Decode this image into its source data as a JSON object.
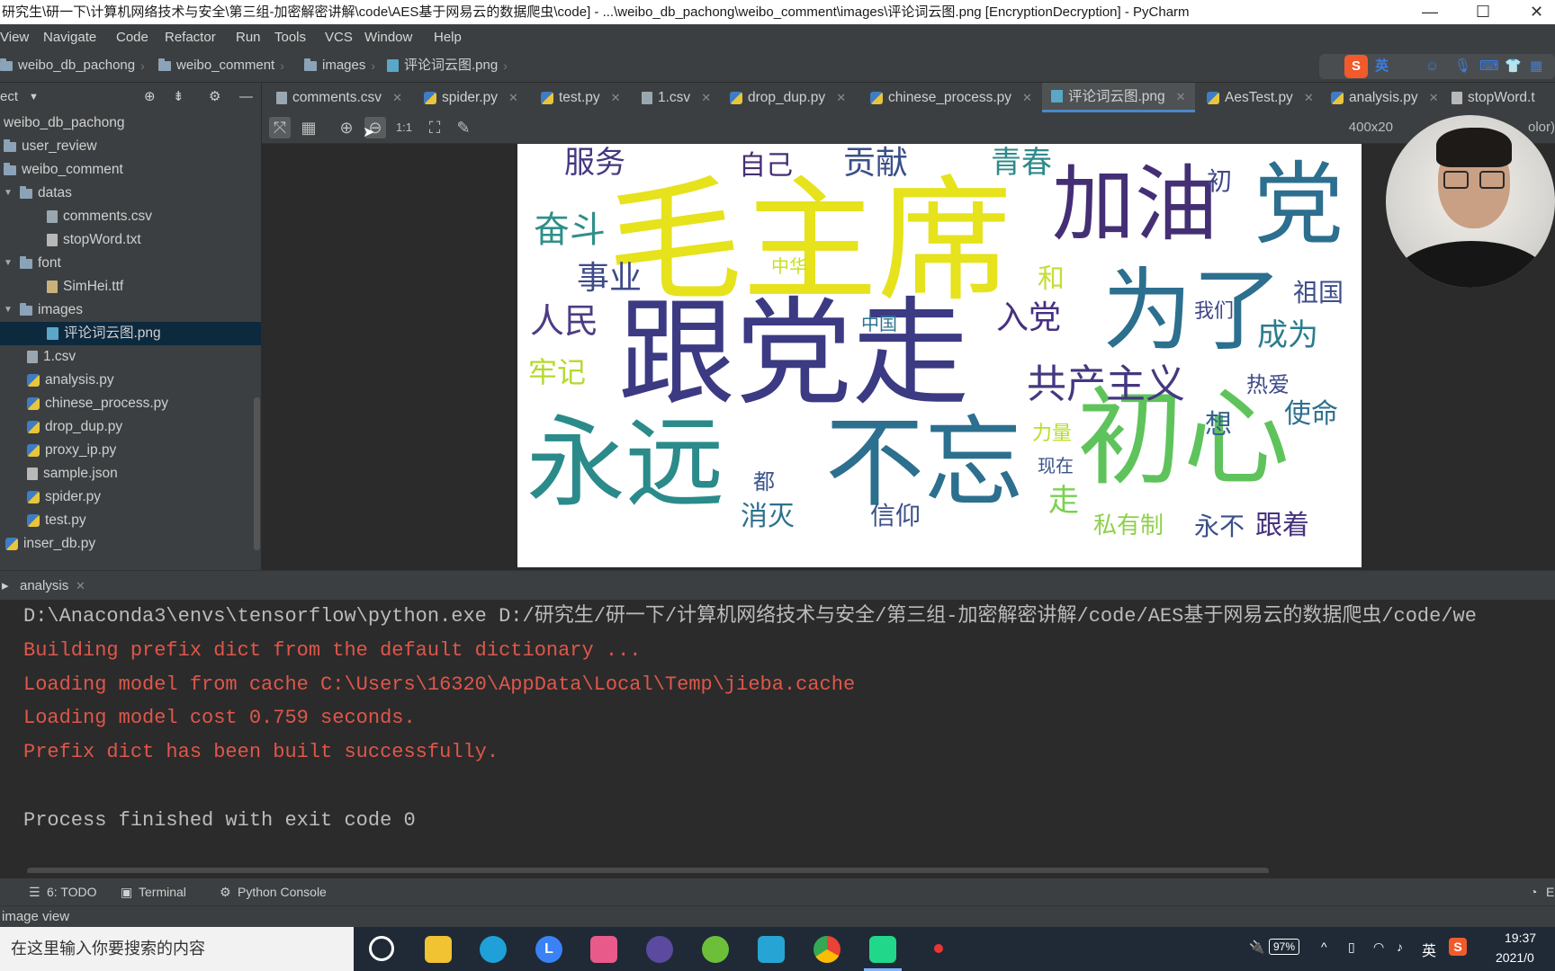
{
  "window": {
    "title": "研究生\\研一下\\计算机网络技术与安全\\第三组-加密解密讲解\\code\\AES基于网易云的数据爬虫\\code] - ...\\weibo_db_pachong\\weibo_comment\\images\\评论词云图.png [EncryptionDecryption] - PyCharm",
    "minimize": "—",
    "maximize": "☐",
    "close": "✕"
  },
  "menu": [
    "View",
    "Navigate",
    "Code",
    "Refactor",
    "Run",
    "Tools",
    "VCS",
    "Window",
    "Help"
  ],
  "breadcrumb": [
    "weibo_db_pachong",
    "weibo_comment",
    "images",
    "评论词云图.png"
  ],
  "ime": {
    "lang": "英"
  },
  "project": {
    "header": "ect",
    "tree": [
      {
        "label": "weibo_db_pachong",
        "type": "none"
      },
      {
        "label": "user_review",
        "type": "folder"
      },
      {
        "label": "weibo_comment",
        "type": "folder"
      },
      {
        "label": "datas",
        "type": "folder-open"
      },
      {
        "label": "comments.csv",
        "type": "csv"
      },
      {
        "label": "stopWord.txt",
        "type": "txt"
      },
      {
        "label": "font",
        "type": "folder-open"
      },
      {
        "label": "SimHei.ttf",
        "type": "font"
      },
      {
        "label": "images",
        "type": "folder-open"
      },
      {
        "label": "评论词云图.png",
        "type": "img",
        "selected": true
      },
      {
        "label": "1.csv",
        "type": "csv"
      },
      {
        "label": "analysis.py",
        "type": "py"
      },
      {
        "label": "chinese_process.py",
        "type": "py"
      },
      {
        "label": "drop_dup.py",
        "type": "py"
      },
      {
        "label": "proxy_ip.py",
        "type": "py"
      },
      {
        "label": "sample.json",
        "type": "json"
      },
      {
        "label": "spider.py",
        "type": "py"
      },
      {
        "label": "test.py",
        "type": "py"
      },
      {
        "label": "inser_db.py",
        "type": "py"
      }
    ]
  },
  "tabs": [
    {
      "label": "comments.csv",
      "type": "csv"
    },
    {
      "label": "spider.py",
      "type": "py"
    },
    {
      "label": "test.py",
      "type": "py"
    },
    {
      "label": "1.csv",
      "type": "csv"
    },
    {
      "label": "drop_dup.py",
      "type": "py"
    },
    {
      "label": "chinese_process.py",
      "type": "py"
    },
    {
      "label": "评论词云图.png",
      "type": "img",
      "active": true
    },
    {
      "label": "AesTest.py",
      "type": "py"
    },
    {
      "label": "analysis.py",
      "type": "py"
    },
    {
      "label": "stopWord.t",
      "type": "txt"
    }
  ],
  "image_toolbar": {
    "actual_size": "1:1",
    "info": "400x20",
    "info_tail": "olor)"
  },
  "wordcloud": {
    "words": [
      {
        "t": "毛主席",
        "c": "#e6e21c"
      },
      {
        "t": "跟党走",
        "c": "#3b3a83"
      },
      {
        "t": "永远",
        "c": "#2a8b8a"
      },
      {
        "t": "不忘",
        "c": "#2d6f8e"
      },
      {
        "t": "初心",
        "c": "#5fc35c"
      },
      {
        "t": "加油",
        "c": "#442f74"
      },
      {
        "t": "党",
        "c": "#2c6f8e"
      },
      {
        "t": "为了",
        "c": "#2c6f8e"
      },
      {
        "t": "共产主义",
        "c": "#453880"
      },
      {
        "t": "服务",
        "c": "#453880"
      },
      {
        "t": "奋斗",
        "c": "#2f8f8a"
      },
      {
        "t": "事业",
        "c": "#3e4b88"
      },
      {
        "t": "人民",
        "c": "#4d3c85"
      },
      {
        "t": "牢记",
        "c": "#b5d930"
      },
      {
        "t": "贡献",
        "c": "#3b4f89"
      },
      {
        "t": "青春",
        "c": "#2f8a8b"
      },
      {
        "t": "自己",
        "c": "#462e76"
      },
      {
        "t": "入党",
        "c": "#473080"
      },
      {
        "t": "成为",
        "c": "#2b7c8d"
      },
      {
        "t": "使命",
        "c": "#2e6f8e"
      },
      {
        "t": "跟着",
        "c": "#46337e"
      },
      {
        "t": "私有制",
        "c": "#8fd14a"
      },
      {
        "t": "永不",
        "c": "#3c4f8a"
      },
      {
        "t": "走",
        "c": "#7ad151"
      },
      {
        "t": "消灭",
        "c": "#2d708e"
      },
      {
        "t": "信仰",
        "c": "#3c508b"
      },
      {
        "t": "祖国",
        "c": "#3d4e8a"
      },
      {
        "t": "热爱",
        "c": "#3e4a89"
      },
      {
        "t": "想",
        "c": "#33638d"
      },
      {
        "t": "和",
        "c": "#c6dd34"
      },
      {
        "t": "力量",
        "c": "#b8de29"
      },
      {
        "t": "现在",
        "c": "#3b528b"
      },
      {
        "t": "都",
        "c": "#3a538b"
      },
      {
        "t": "我们",
        "c": "#3f4788"
      },
      {
        "t": "中国",
        "c": "#2c728e"
      },
      {
        "t": "中华",
        "c": "#c8e020"
      },
      {
        "t": "初",
        "c": "#404588"
      }
    ]
  },
  "run": {
    "tab": "analysis",
    "lines": [
      {
        "text": "D:\\Anaconda3\\envs\\tensorflow\\python.exe D:/研究生/研一下/计算机网络技术与安全/第三组-加密解密讲解/code/AES基于网易云的数据爬虫/code/we",
        "color": "#bbbbbb"
      },
      {
        "text": "Building prefix dict from the default dictionary ...",
        "color": "#e0564a"
      },
      {
        "text": "Loading model from cache C:\\Users\\16320\\AppData\\Local\\Temp\\jieba.cache",
        "color": "#e0564a"
      },
      {
        "text": "Loading model cost 0.759 seconds.",
        "color": "#e0564a"
      },
      {
        "text": "Prefix dict has been built successfully.",
        "color": "#e0564a"
      },
      {
        "text": "",
        "color": "#bbbbbb"
      },
      {
        "text": "Process finished with exit code 0",
        "color": "#bbbbbb"
      }
    ]
  },
  "toolstrip": [
    "6: TODO",
    "Terminal",
    "Python Console"
  ],
  "toolstrip_right": "E",
  "status": "image view",
  "taskbar": {
    "search_placeholder": "在这里输入你要搜索的内容",
    "battery": "97%",
    "time": "19:37",
    "date": "2021/0",
    "lang": "英"
  }
}
